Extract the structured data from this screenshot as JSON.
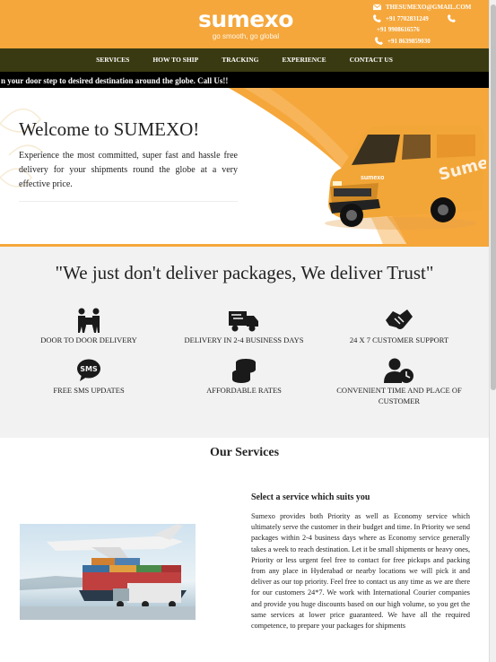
{
  "header": {
    "logo": "sumexo",
    "tagline": "go smooth, go global",
    "email": "THESUMEXO@GMAIL.COM",
    "phone1": "+91 7702831249",
    "phone2": "+91 9908616576",
    "phone3": "+91 8639859030"
  },
  "nav": [
    "SERVICES",
    "HOW TO SHIP",
    "TRACKING",
    "EXPERIENCE",
    "CONTACT US"
  ],
  "ticker": "n your door step to desired destination around the globe. Call Us!!",
  "hero": {
    "title": "Welcome to SUMEXO!",
    "text": "Experience the most committed, super fast and hassle free delivery for your shipments round the globe at a very effective price."
  },
  "features": {
    "title": "\"We just don't deliver packages, We deliver Trust\"",
    "items": [
      {
        "label": "DOOR TO DOOR DELIVERY",
        "icon": "delivery-men-icon"
      },
      {
        "label": "DELIVERY IN 2-4 BUSINESS DAYS",
        "icon": "truck-icon"
      },
      {
        "label": "24 X 7 CUSTOMER SUPPORT",
        "icon": "handshake-icon"
      },
      {
        "label": "FREE SMS UPDATES",
        "icon": "sms-icon"
      },
      {
        "label": "AFFORDABLE RATES",
        "icon": "coins-icon"
      },
      {
        "label": "CONVENIENT TIME AND PLACE OF CUSTOMER",
        "icon": "user-clock-icon"
      }
    ]
  },
  "services": {
    "title": "Our Services",
    "subtitle": "Select a service which suits you",
    "text": "Sumexo provides both Priority as well as Economy service which ultimately serve the customer in their budget and time. In Priority we send packages within 2-4 business days where as Economy service generally takes a week to reach destination. Let it be small shipments or heavy ones, Priority or less urgent feel free to contact for free pickups and packing from any place in Hyderabad or nearby locations we will pick it and deliver as our top priority. Feel free to contact us any time as we are there for our customers 24*7. We work with International Courier companies and provide you huge discounts based on our high volume, so you get the same services at lower price guaranteed. We have all the required competence, to prepare your packages for shipments"
  },
  "colors": {
    "brand": "#f5a73b",
    "nav_bg": "#3a3a12",
    "ticker_bg": "#000000",
    "features_bg": "#f2f2f2"
  }
}
